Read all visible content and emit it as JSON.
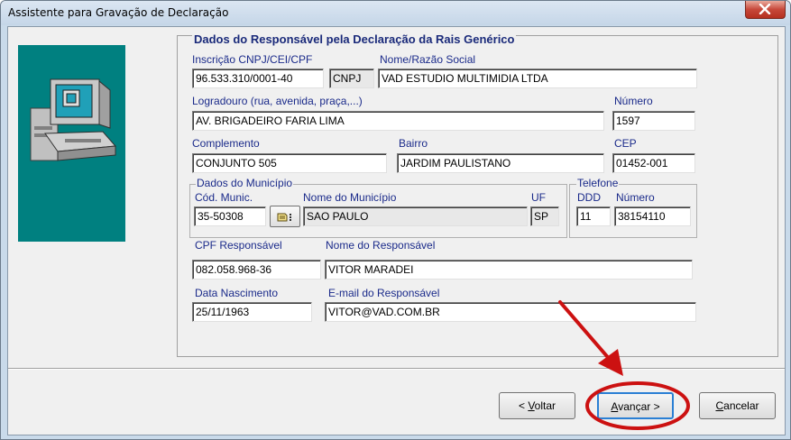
{
  "window": {
    "title": "Assistente para Gravação de Declaração"
  },
  "section": {
    "heading": "Dados do Responsável pela Declaração da Rais Genérico"
  },
  "form": {
    "cnpj_label": "Inscrição CNPJ/CEI/CPF",
    "cnpj_value": "96.533.310/0001-40",
    "cnpj_type": "CNPJ",
    "razao_label": "Nome/Razão Social",
    "razao_value": "VAD ESTUDIO MULTIMIDIA LTDA",
    "logradouro_label": "Logradouro (rua, avenida, praça,...)",
    "logradouro_value": "AV. BRIGADEIRO FARIA LIMA",
    "numero_label": "Número",
    "numero_value": "1597",
    "complemento_label": "Complemento",
    "complemento_value": "CONJUNTO 505",
    "bairro_label": "Bairro",
    "bairro_value": "JARDIM PAULISTANO",
    "cep_label": "CEP",
    "cep_value": "01452-001",
    "municipio_group": "Dados do Município",
    "cod_munic_label": "Cód. Munic.",
    "cod_munic_value": "35-50308",
    "nome_munic_label": "Nome do Município",
    "nome_munic_value": "SAO PAULO",
    "uf_label": "UF",
    "uf_value": "SP",
    "telefone_group": "Telefone",
    "ddd_label": "DDD",
    "ddd_value": "11",
    "tel_numero_label": "Número",
    "tel_numero_value": "38154110",
    "cpf_resp_label": "CPF Responsável",
    "cpf_resp_value": "082.058.968-36",
    "nome_resp_label": "Nome do Responsável",
    "nome_resp_value": "VITOR MARADEI",
    "nasc_label": "Data Nascimento",
    "nasc_value": "25/11/1963",
    "email_label": "E-mail do Responsável",
    "email_value": "VITOR@VAD.COM.BR"
  },
  "buttons": {
    "back_prefix": "< ",
    "back_mnemonic": "V",
    "back_rest": "oltar",
    "next_mnemonic": "A",
    "next_rest": "vançar >",
    "cancel_mnemonic": "C",
    "cancel_rest": "ancelar"
  },
  "annotation": {
    "color": "#cc1111"
  },
  "icons": {
    "side_image": "computer-icon",
    "picker": "search-list-icon",
    "close": "close-icon"
  }
}
